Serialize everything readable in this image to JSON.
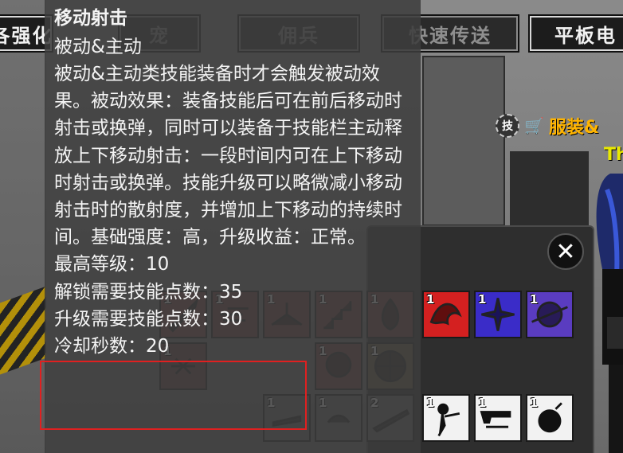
{
  "nav": {
    "items": [
      {
        "label": "各强化",
        "state": "partial"
      },
      {
        "label": "宠",
        "state": "dim"
      },
      {
        "label": "佣兵",
        "state": "dim"
      },
      {
        "label": "快速传送",
        "state": "dim"
      },
      {
        "label": "平板电",
        "state": "normal"
      }
    ]
  },
  "npc": {
    "badge": "技",
    "cart_icon": "shopping-cart-icon",
    "label": "服装&",
    "sub": "The"
  },
  "skill_panel": {
    "close_icon": "close-icon",
    "slots": [
      {
        "level": "1",
        "icon": "dragon-icon",
        "color": "#d42020"
      },
      {
        "level": "1",
        "icon": "sparkle-icon",
        "color": "#3a2cc8"
      },
      {
        "level": "1",
        "icon": "planet-icon",
        "color": "#5a3cc0"
      },
      {
        "level": "1",
        "icon": "sword-icon",
        "color": "#8a4a4a"
      },
      {
        "level": "1",
        "icon": "dash-icon",
        "color": "#7a4040"
      },
      {
        "level": "1",
        "icon": "slide-icon",
        "color": "#7a4040"
      },
      {
        "level": "1",
        "icon": "stairs-icon",
        "color": "#7a4040"
      },
      {
        "level": "1",
        "icon": "flame-icon",
        "color": "#7a4040"
      },
      {
        "level": "1",
        "icon": "hands-icon",
        "color": "#6a4040"
      },
      {
        "level": "1",
        "icon": "skull-icon",
        "color": "#7a4040"
      },
      {
        "level": "1",
        "icon": "wheel-icon",
        "color": "#6a5a40"
      },
      {
        "level": "1",
        "icon": "magazine-icon",
        "color": "#6a6a6a"
      },
      {
        "level": "1",
        "icon": "blade-icon",
        "color": "#6a6a6a"
      },
      {
        "level": "2",
        "icon": "rifle-icon",
        "color": "#6a6a6a"
      },
      {
        "level": "1",
        "icon": "gunner-icon",
        "color": "#f2f2f2"
      },
      {
        "level": "1",
        "icon": "guns-icon",
        "color": "#f2f2f2"
      },
      {
        "level": "1",
        "icon": "bomb-icon",
        "color": "#f2f2f2"
      }
    ]
  },
  "tooltip": {
    "title": "移动射击",
    "type": "被动&主动",
    "description": "被动&主动类技能装备时才会触发被动效果。被动效果：装备技能后可在前后移动时射击或换弹，同时可以装备于技能栏主动释放上下移动射击：一段时间内可在上下移动时射击或换弹。技能升级可以略微减小移动射击时的散射度，并增加上下移动的持续时间。基础强度：高，升级收益：正常。",
    "max_level": "最高等级：10",
    "unlock_cost": "解锁需要技能点数：35",
    "upgrade_cost": "升级需要技能点数：30",
    "cooldown": "冷却秒数：20"
  },
  "colors": {
    "tooltip_bg": "#3c3c3c",
    "highlight": "#e02020",
    "npc_text": "#ffb400",
    "npc_sub": "#e8e800"
  }
}
